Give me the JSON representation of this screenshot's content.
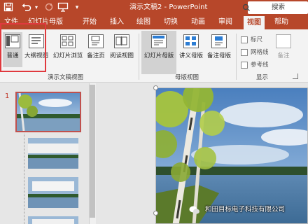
{
  "titlebar": {
    "title": "演示文稿2 - PowerPoint",
    "search_placeholder": "搜索(Alt+Q)",
    "icons": [
      "save-icon",
      "undo-icon",
      "redo-icon",
      "slideshow-from-beginning-icon"
    ]
  },
  "tabs": [
    "文件",
    "幻灯片母版",
    "开始",
    "插入",
    "绘图",
    "切换",
    "动画",
    "审阅",
    "视图",
    "帮助"
  ],
  "active_tab": "视图",
  "ribbon": {
    "presentation_views": {
      "buttons": [
        "普通",
        "大纲视图",
        "幻灯片浏览",
        "备注页",
        "阅读视图"
      ],
      "selected": "普通",
      "group_label": "演示文稿视图"
    },
    "master_views": {
      "buttons": [
        "幻灯片母版",
        "讲义母版",
        "备注母版"
      ],
      "group_label": "母版视图"
    },
    "show": {
      "checkboxes": [
        "标尺",
        "网格线",
        "参考线"
      ],
      "notes_label": "备注",
      "group_label": "显示"
    }
  },
  "thumbnails": {
    "first_number": "1"
  },
  "watermark": "和田目标电子科技有限公司",
  "colors": {
    "accent": "#b7472a",
    "highlight_box": "#e0393e"
  }
}
